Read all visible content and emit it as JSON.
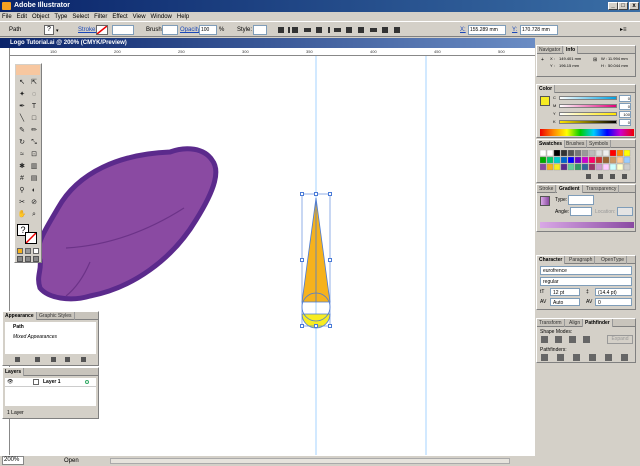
{
  "app": {
    "title": "Adobe Illustrator"
  },
  "menu": [
    "File",
    "Edit",
    "Object",
    "Type",
    "Select",
    "Filter",
    "Effect",
    "View",
    "Window",
    "Help"
  ],
  "control": {
    "object_type": "Path",
    "fill_label": "?",
    "stroke_label": "Stroke:",
    "brush_label": "Brush:",
    "opacity_label": "Opacity:",
    "opacity_value": "100",
    "opacity_unit": "%",
    "style_label": "Style:",
    "x_label": "X:",
    "x_value": "155.289 mm",
    "y_label": "Y:",
    "y_value": "170.728 mm"
  },
  "document": {
    "title": "Logo Tutorial.ai @ 200% (CMYK/Preview)"
  },
  "ruler": [
    "150",
    "200",
    "250",
    "300",
    "350",
    "400",
    "450",
    "500"
  ],
  "status": {
    "zoom": "200%",
    "state": "Open"
  },
  "panels": {
    "navigator": {
      "tabs": [
        "Navigator",
        "Info"
      ],
      "x_label": "X :",
      "x_value": "149.401 mm",
      "y_label": "Y :",
      "y_value": "196.15 mm",
      "w_label": "W :",
      "w_value": "11.994 mm",
      "h_label": "H :",
      "h_value": "50.044 mm"
    },
    "color": {
      "tab": "Color",
      "channels": [
        {
          "label": "C",
          "value": "0"
        },
        {
          "label": "M",
          "value": "0"
        },
        {
          "label": "Y",
          "value": "100"
        },
        {
          "label": "K",
          "value": "0"
        }
      ]
    },
    "swatches": {
      "tabs": [
        "Swatches",
        "Brushes",
        "Symbols"
      ]
    },
    "gradient": {
      "tabs": [
        "Stroke",
        "Gradient",
        "Transparency"
      ],
      "type_label": "Type:",
      "angle_label": "Angle:",
      "location_label": "Location:"
    },
    "character": {
      "tabs": [
        "Character",
        "Paragraph",
        "OpenType"
      ],
      "font": "eurofrence",
      "style": "regular",
      "size": "12 pt",
      "leading": "(14.4 pt)",
      "tracking": "Auto",
      "kerning": "0"
    },
    "pathfinder": {
      "tabs": [
        "Transform",
        "Align",
        "Pathfinder"
      ],
      "shape_modes": "Shape Modes:",
      "expand": "Expand",
      "pathfinders": "Pathfinders:"
    },
    "appearance": {
      "tabs": [
        "Appearance",
        "Graphic Styles"
      ],
      "path": "Path",
      "mixed": "Mixed Appearances"
    },
    "layers": {
      "tab": "Layers",
      "layer_name": "Layer 1",
      "count": "1 Layer"
    }
  },
  "colors": {
    "purple": "#8a4aa2",
    "purple_stroke": "#5b2a8c",
    "orange": "#f6b21c",
    "yellow": "#f7ec23",
    "selection": "#4a7bd8"
  }
}
